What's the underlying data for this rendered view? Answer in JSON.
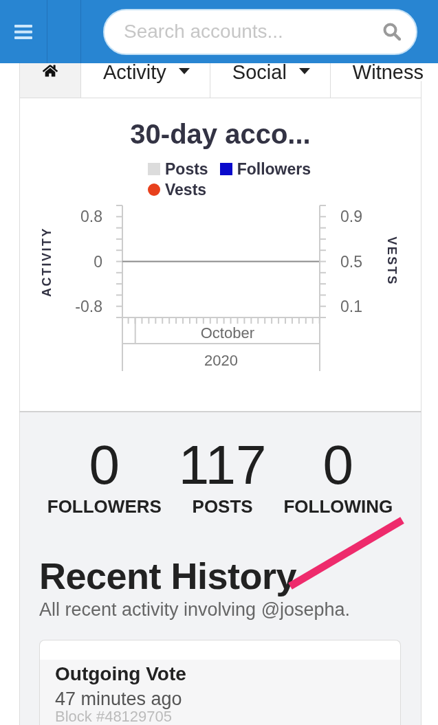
{
  "header": {
    "search": {
      "placeholder": "Search accounts..."
    }
  },
  "tabs": [
    {
      "kind": "home",
      "selected": true
    },
    {
      "kind": "text",
      "label": "Activity",
      "dropdown": true,
      "selected": false
    },
    {
      "kind": "text",
      "label": "Social",
      "dropdown": true,
      "selected": false
    },
    {
      "kind": "text",
      "label": "Witness",
      "dropdown": false,
      "selected": false
    }
  ],
  "chart": {
    "title": "30-day acco...",
    "legend": [
      {
        "label": "Posts",
        "kind": "square",
        "color": "#dcdcdc"
      },
      {
        "label": "Followers",
        "kind": "square",
        "color": "#0a0acc"
      },
      {
        "label": "Vests",
        "kind": "circle",
        "color": "#e8401c"
      }
    ],
    "left_axis": {
      "title": "ACTIVITY",
      "ticks": [
        "0.8",
        "0",
        "-0.8"
      ]
    },
    "right_axis": {
      "title": "VESTS",
      "ticks": [
        "0.9",
        "0.5",
        "0.1"
      ]
    },
    "x_axis": {
      "month": "October",
      "year": "2020"
    }
  },
  "stats": [
    {
      "value": "0",
      "label": "FOLLOWERS"
    },
    {
      "value": "117",
      "label": "POSTS"
    },
    {
      "value": "0",
      "label": "FOLLOWING"
    }
  ],
  "history": {
    "title": "Recent History",
    "subtitle": "All recent activity involving @josepha.",
    "items": [
      {
        "title": "Outgoing Vote",
        "time": "47 minutes ago",
        "block": "Block #48129705"
      }
    ]
  }
}
